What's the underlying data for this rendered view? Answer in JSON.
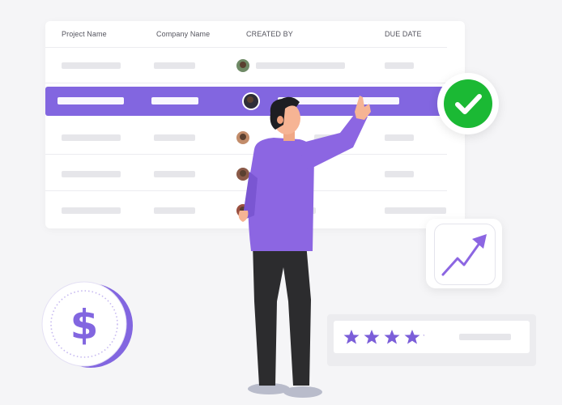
{
  "table": {
    "headers": [
      "Project Name",
      "Company Name",
      "CREATED BY",
      "DUE DATE"
    ]
  },
  "colors": {
    "accent": "#8266e0",
    "check_green": "#1bb934",
    "star_purple": "#7b5ed9",
    "background": "#f5f5f7"
  },
  "icons": {
    "check": "check-icon",
    "trend": "trend-up-icon",
    "coin": "dollar-coin-icon",
    "stars": "star-icon"
  },
  "rating": {
    "stars_filled": 4.5,
    "stars_total": 5
  }
}
